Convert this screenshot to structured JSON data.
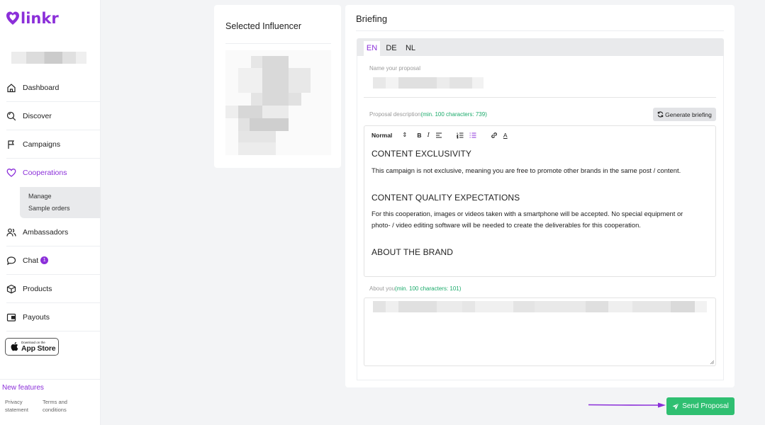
{
  "brand": {
    "name": "linkr",
    "accent": "#8b2fd9"
  },
  "sidebar": {
    "items": [
      {
        "label": "Dashboard",
        "icon": "home-icon"
      },
      {
        "label": "Discover",
        "icon": "search-icon"
      },
      {
        "label": "Campaigns",
        "icon": "flag-icon"
      },
      {
        "label": "Cooperations",
        "icon": "heart-icon"
      },
      {
        "label": "Ambassadors",
        "icon": "users-icon"
      },
      {
        "label": "Chat",
        "icon": "chat-icon"
      },
      {
        "label": "Products",
        "icon": "box-icon"
      },
      {
        "label": "Payouts",
        "icon": "wallet-icon"
      }
    ],
    "subitems": [
      "Manage",
      "Sample orders"
    ],
    "chat_badge": "1",
    "appstore": {
      "small": "Download on the",
      "big": "App Store"
    },
    "new_features": "New features",
    "footer": {
      "privacy_line1": "Privacy",
      "privacy_line2": "statement",
      "terms_line1": "Terms and",
      "terms_line2": "conditions"
    }
  },
  "influencer_card": {
    "title": "Selected Influencer"
  },
  "briefing": {
    "title": "Briefing",
    "languages": [
      "EN",
      "DE",
      "NL"
    ],
    "active_language": "EN",
    "name_label": "Name your proposal",
    "description_label": "Proposal description",
    "description_hint": "(min. 100 characters: 739)",
    "generate_button": "Generate briefing",
    "toolbar": {
      "style": "Normal",
      "bold": "B",
      "italic": "I",
      "color": "A"
    },
    "content": {
      "h1": "CONTENT EXCLUSIVITY",
      "p1": "This campaign is not exclusive, meaning you are free to promote other brands in the same post / content.",
      "h2": "CONTENT QUALITY EXPECTATIONS",
      "p2a": "For this cooperation, images or videos taken with a smartphone will be accepted. No special equipment or",
      "p2b": "photo- / video editing software will be needed to create the deliverables for this cooperation.",
      "h3": "ABOUT THE BRAND"
    },
    "about_label": "About you",
    "about_hint": "(min. 100 characters: 101)",
    "send_button": "Send Proposal"
  },
  "colors": {
    "green": "#2fbf71",
    "green_text": "#1aaa6a",
    "arrow": "#8b2fd9"
  }
}
